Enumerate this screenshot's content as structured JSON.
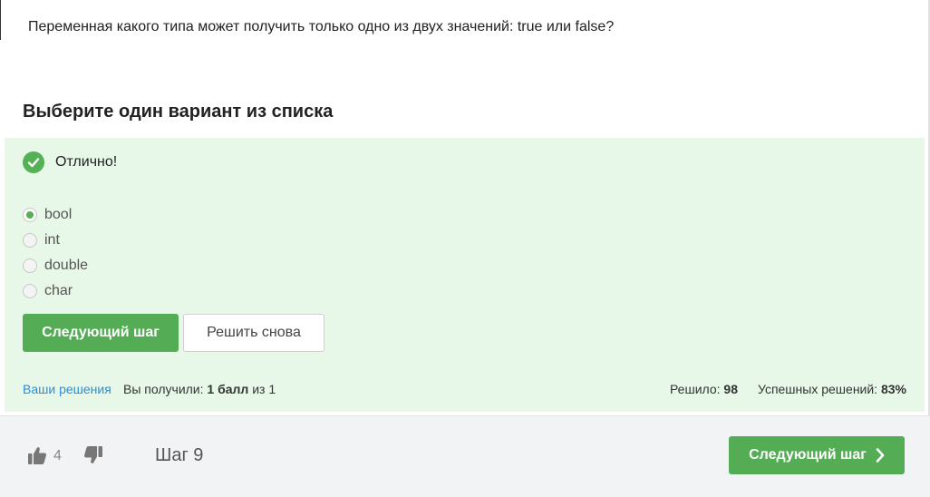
{
  "question": "Переменная какого типа может получить только одно из двух значений: true или false?",
  "task": {
    "title": "Выберите один вариант из списка"
  },
  "feedback": {
    "text": "Отлично!",
    "icon": "check-circle-icon",
    "color": "#54b155"
  },
  "options": [
    {
      "label": "bool",
      "selected": true
    },
    {
      "label": "int",
      "selected": false
    },
    {
      "label": "double",
      "selected": false
    },
    {
      "label": "char",
      "selected": false
    }
  ],
  "buttons": {
    "next_step": "Следующий шаг",
    "retry": "Решить снова"
  },
  "footer": {
    "solutions_link": "Ваши решения",
    "score_prefix": "Вы получили: ",
    "score_value": "1 балл",
    "score_suffix": " из 1",
    "solved_label": "Решило: ",
    "solved_value": "98",
    "success_label": "Успешных решений: ",
    "success_value": "83%"
  },
  "bottom_bar": {
    "likes": "4",
    "step": "Шаг 9",
    "next_step": "Следующий шаг"
  },
  "colors": {
    "accent": "#54ad54",
    "answer_bg": "#e7f7e8",
    "link": "#2c8dd9"
  }
}
